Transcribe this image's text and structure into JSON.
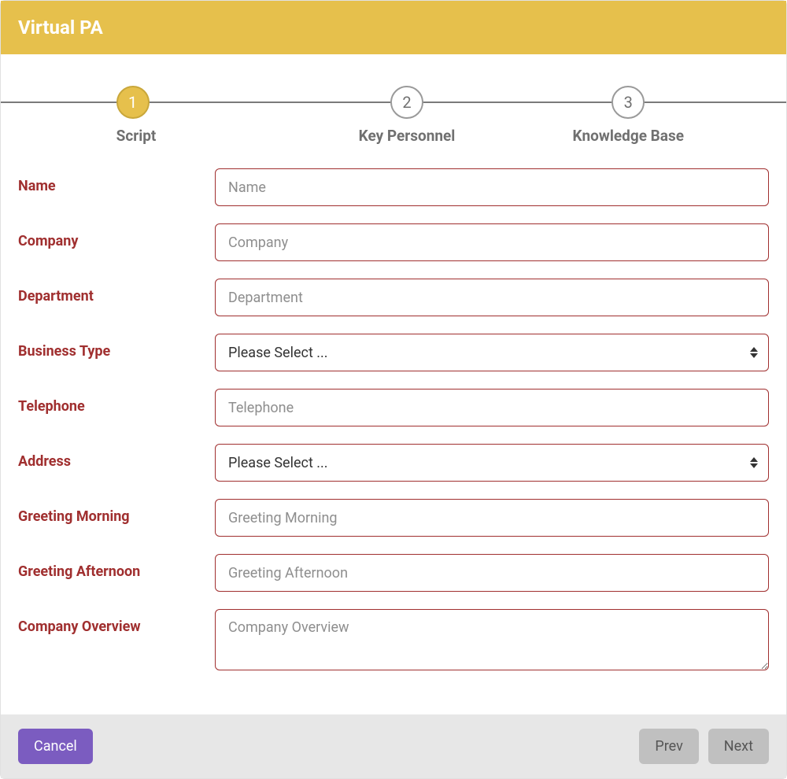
{
  "header": {
    "title": "Virtual PA"
  },
  "stepper": {
    "steps": [
      {
        "num": "1",
        "label": "Script",
        "active": true
      },
      {
        "num": "2",
        "label": "Key Personnel",
        "active": false
      },
      {
        "num": "3",
        "label": "Knowledge Base",
        "active": false
      }
    ]
  },
  "form": {
    "name": {
      "label": "Name",
      "placeholder": "Name",
      "value": ""
    },
    "company": {
      "label": "Company",
      "placeholder": "Company",
      "value": ""
    },
    "department": {
      "label": "Department",
      "placeholder": "Department",
      "value": ""
    },
    "business_type": {
      "label": "Business Type",
      "selected": "Please Select ..."
    },
    "telephone": {
      "label": "Telephone",
      "placeholder": "Telephone",
      "value": ""
    },
    "address": {
      "label": "Address",
      "selected": "Please Select ..."
    },
    "greeting_morning": {
      "label": "Greeting Morning",
      "placeholder": "Greeting Morning",
      "value": ""
    },
    "greeting_afternoon": {
      "label": "Greeting Afternoon",
      "placeholder": "Greeting Afternoon",
      "value": ""
    },
    "company_overview": {
      "label": "Company Overview",
      "placeholder": "Company Overview",
      "value": ""
    }
  },
  "footer": {
    "cancel": "Cancel",
    "prev": "Prev",
    "next": "Next"
  },
  "colors": {
    "accent": "#e6c04c",
    "label": "#a02f2f",
    "primary_btn": "#7b5cc0"
  }
}
